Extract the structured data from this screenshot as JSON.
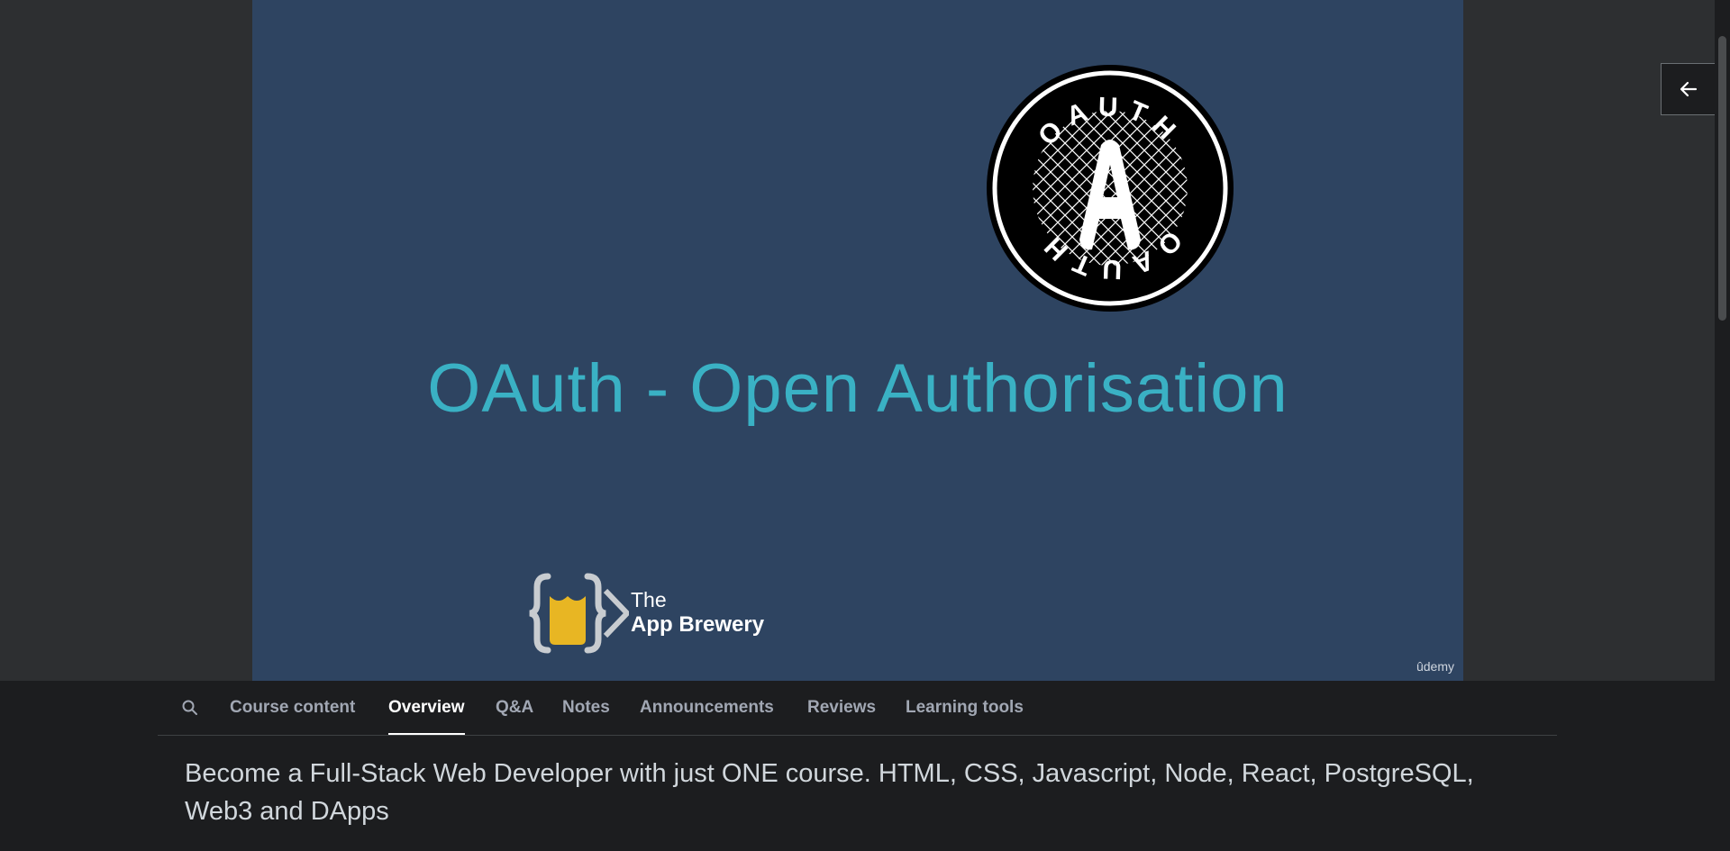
{
  "slide": {
    "logo_top_text": "OAUTH",
    "logo_bottom_text": "OAUTH",
    "logo_letter": "A",
    "title": "OAuth - Open Authorisation",
    "brand_line1": "The",
    "brand_line2": "App Brewery",
    "watermark": "ûdemy",
    "background_color": "#2e4461",
    "title_color": "#3ab1c4"
  },
  "sidebar_toggle": {
    "icon": "arrow-left-icon"
  },
  "tabs": {
    "search_icon": "search-icon",
    "items": [
      {
        "label": "Course content"
      },
      {
        "label": "Overview"
      },
      {
        "label": "Q&A"
      },
      {
        "label": "Notes"
      },
      {
        "label": "Announcements"
      },
      {
        "label": "Reviews"
      },
      {
        "label": "Learning tools"
      }
    ],
    "active": "Overview"
  },
  "course": {
    "description": "Become a Full-Stack Web Developer with just ONE course. HTML, CSS, Javascript, Node, React, PostgreSQL, Web3 and DApps"
  }
}
